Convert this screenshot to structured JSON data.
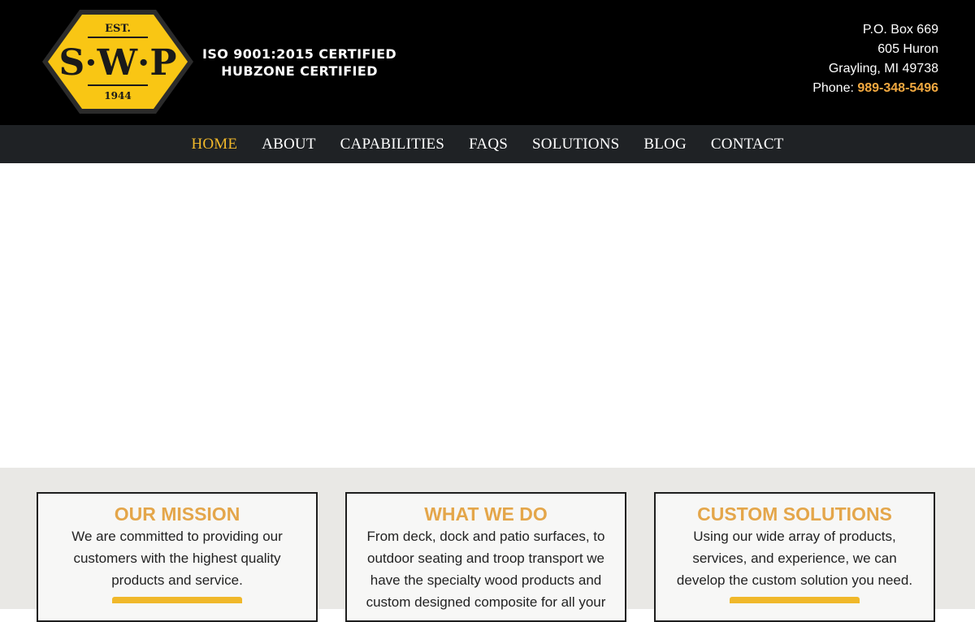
{
  "header": {
    "logo": {
      "est": "EST.",
      "letters": "S·W·P",
      "year": "1944",
      "fill": "#f9c614",
      "border": "#2b2b2b"
    },
    "certifications": [
      "ISO 9001:2015 CERTIFIED",
      "HUBZONE CERTIFIED"
    ],
    "address": {
      "line1": "P.O. Box 669",
      "line2": "605 Huron",
      "line3": "Grayling, MI 49738",
      "phone_label": "Phone: ",
      "phone_number": "989-348-5496"
    }
  },
  "nav": {
    "items": [
      {
        "label": "HOME",
        "active": true
      },
      {
        "label": "ABOUT"
      },
      {
        "label": "CAPABILITIES"
      },
      {
        "label": "FAQS"
      },
      {
        "label": "SOLUTIONS"
      },
      {
        "label": "BLOG"
      },
      {
        "label": "CONTACT"
      }
    ]
  },
  "features": [
    {
      "title": "OUR MISSION",
      "text": "We are committed to providing our customers with the highest quality products and service."
    },
    {
      "title": "WHAT WE DO",
      "text": "From deck, dock and patio surfaces, to outdoor seating and troop transport we have the specialty wood products and custom designed composite for all your"
    },
    {
      "title": "CUSTOM SOLUTIONS",
      "text": "Using our wide array of products, services, and experience, we can develop the custom solution you need."
    }
  ],
  "colors": {
    "accent": "#f2a940",
    "nav_active": "#f0b82a",
    "header_bg": "#000000",
    "nav_bg": "#1f2225",
    "features_bg": "#e9e8e5"
  }
}
